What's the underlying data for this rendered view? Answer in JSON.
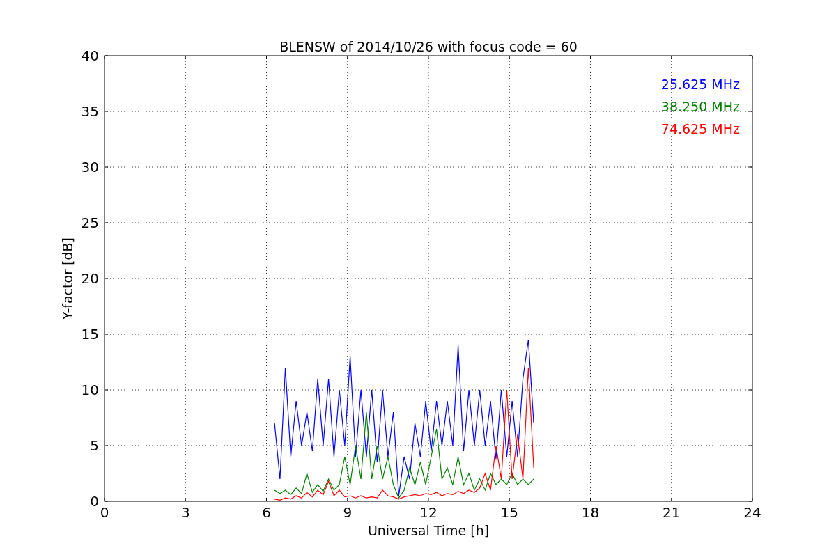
{
  "chart_data": {
    "type": "line",
    "title": "BLENSW of 2014/10/26 with focus code = 60",
    "xlabel": "Universal Time [h]",
    "ylabel": "Y-factor [dB]",
    "x": [
      6.3,
      6.5,
      6.7,
      6.9,
      7.1,
      7.3,
      7.5,
      7.7,
      7.9,
      8.1,
      8.3,
      8.5,
      8.7,
      8.9,
      9.1,
      9.3,
      9.5,
      9.7,
      9.9,
      10.1,
      10.3,
      10.5,
      10.7,
      10.9,
      11.1,
      11.3,
      11.5,
      11.7,
      11.9,
      12.1,
      12.3,
      12.5,
      12.7,
      12.9,
      13.1,
      13.3,
      13.5,
      13.7,
      13.9,
      14.1,
      14.3,
      14.5,
      14.7,
      14.9,
      15.1,
      15.3,
      15.5,
      15.7,
      15.9
    ],
    "series": [
      {
        "name": "25.625 MHz",
        "color": "#0000ff",
        "values": [
          7,
          2,
          12,
          4,
          9,
          5,
          8,
          4.5,
          11,
          5,
          11,
          4,
          10,
          5,
          13,
          4,
          10,
          4,
          10,
          3.5,
          10,
          4,
          8,
          0.5,
          4,
          2,
          7,
          4,
          9,
          4.5,
          9,
          5,
          9,
          5,
          14,
          4.5,
          10,
          5,
          10,
          5,
          9,
          3.8,
          10,
          4,
          9,
          4,
          11,
          14.5,
          7
        ]
      },
      {
        "name": "38.250 MHz",
        "color": "#008000",
        "values": [
          1,
          0.7,
          1,
          0.6,
          1.2,
          0.7,
          2.5,
          0.8,
          1.5,
          0.9,
          2,
          1,
          1.5,
          4,
          1.5,
          5,
          2,
          8,
          2,
          5,
          2,
          4,
          1.5,
          0.3,
          1,
          3,
          1.5,
          3.5,
          1.5,
          4,
          6.5,
          2,
          3,
          1.5,
          4,
          1.5,
          2.5,
          1,
          2,
          1,
          2.5,
          1.5,
          2,
          1.5,
          2.5,
          1.5,
          2,
          1.5,
          2
        ]
      },
      {
        "name": "74.625 MHz",
        "color": "#ff0000",
        "values": [
          0.2,
          0.1,
          0.3,
          0.2,
          0.5,
          0.3,
          0.8,
          0.4,
          1,
          0.6,
          1.8,
          0.5,
          1,
          0.4,
          0.5,
          0.3,
          0.5,
          0.3,
          0.4,
          0.3,
          1,
          0.5,
          0.4,
          0.2,
          0.4,
          0.5,
          0.6,
          0.5,
          0.7,
          0.6,
          0.8,
          0.5,
          0.7,
          0.6,
          0.9,
          0.7,
          1,
          0.8,
          1.2,
          2.5,
          1,
          5,
          2,
          10,
          2,
          6,
          2,
          12,
          3
        ]
      }
    ],
    "grid": true,
    "xlim": [
      0,
      24
    ],
    "ylim": [
      0,
      40
    ],
    "xticks": [
      0,
      3,
      6,
      9,
      12,
      15,
      18,
      21,
      24
    ],
    "yticks": [
      0,
      5,
      10,
      15,
      20,
      25,
      30,
      35,
      40
    ]
  }
}
